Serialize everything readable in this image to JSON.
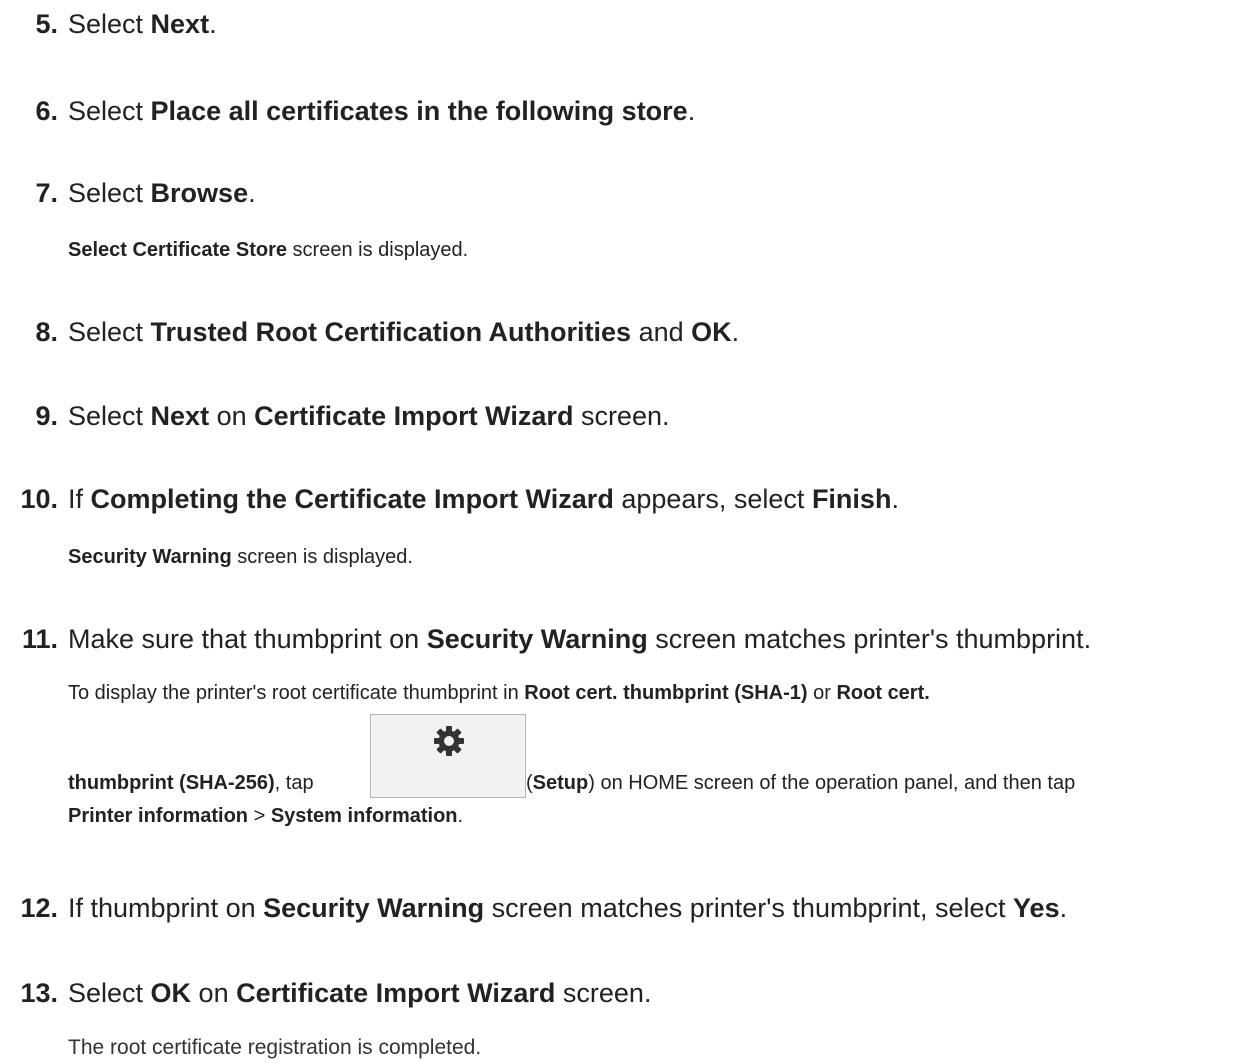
{
  "steps": {
    "s5": {
      "num": "5.",
      "pre": "Select ",
      "b1": "Next",
      "post": "."
    },
    "s6": {
      "num": "6.",
      "pre": "Select ",
      "b1": "Place all certificates in the following store",
      "post": "."
    },
    "s7": {
      "num": "7.",
      "pre": "Select ",
      "b1": "Browse",
      "post": ".",
      "note_b": "Select Certificate Store",
      "note_rest": " screen is displayed."
    },
    "s8": {
      "num": "8.",
      "pre": "Select ",
      "b1": "Trusted Root Certification Authorities",
      "mid": " and ",
      "b2": "OK",
      "post": "."
    },
    "s9": {
      "num": "9.",
      "pre": "Select ",
      "b1": "Next",
      "mid": " on ",
      "b2": "Certificate Import Wizard",
      "post": " screen."
    },
    "s10": {
      "num": "10.",
      "pre": "If ",
      "b1": "Completing the Certificate Import Wizard",
      "mid": " appears, select ",
      "b2": "Finish",
      "post": ".",
      "note_b": "Security Warning",
      "note_rest": " screen is displayed."
    },
    "s11": {
      "num": "11.",
      "pre": "Make sure that thumbprint on ",
      "b1": "Security Warning",
      "post": " screen matches printer's thumbprint.",
      "note1_pre": "To display the printer's root certificate thumbprint in ",
      "note1_b1": "Root cert. thumbprint (SHA-1)",
      "note1_mid": " or ",
      "note1_b2": "Root cert.",
      "note2_b1": "thumbprint (SHA-256)",
      "note2_mid": ", tap ",
      "note2_open": "(",
      "note2_b2": "Setup",
      "note2_rest": ") on HOME screen of the operation panel, and then tap",
      "note3_b1": "Printer information",
      "note3_mid": " > ",
      "note3_b2": "System information",
      "note3_post": ".",
      "icon": "gear-icon"
    },
    "s12": {
      "num": "12.",
      "pre": "If thumbprint on ",
      "b1": "Security Warning",
      "mid": " screen matches printer's thumbprint, select ",
      "b2": "Yes",
      "post": "."
    },
    "s13": {
      "num": "13.",
      "pre": "Select ",
      "b1": "OK",
      "mid": " on ",
      "b2": "Certificate Import Wizard",
      "post": " screen.",
      "note": "The root certificate registration is completed."
    }
  }
}
